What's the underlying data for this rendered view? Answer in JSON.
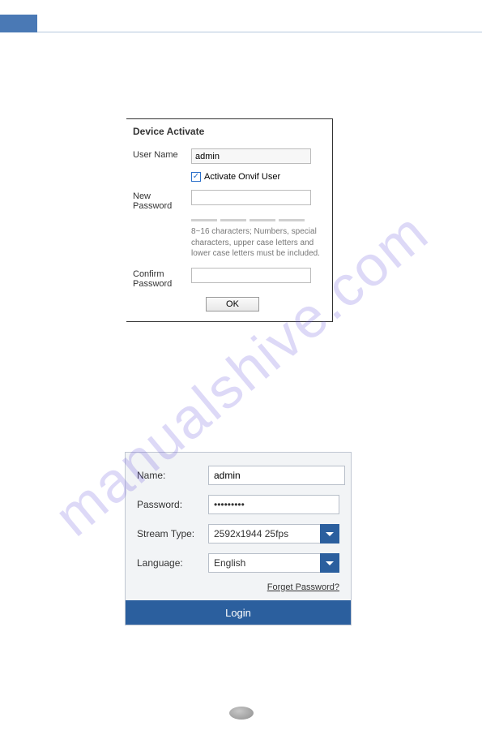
{
  "watermark": "manualshive.com",
  "panel1": {
    "title": "Device Activate",
    "username_label": "User Name",
    "username_value": "admin",
    "checkbox_label": "Activate Onvif User",
    "newpass_label": "New Password",
    "hint": "8~16 characters; Numbers, special characters, upper case letters and lower case letters must be included.",
    "confirm_label": "Confirm Password",
    "ok_label": "OK"
  },
  "panel2": {
    "name_label": "Name:",
    "name_value": "admin",
    "password_label": "Password:",
    "password_value": "•••••••••",
    "stream_label": "Stream Type:",
    "stream_value": "2592x1944 25fps",
    "language_label": "Language:",
    "language_value": "English",
    "forget_link": "Forget Password?",
    "login_label": "Login"
  }
}
